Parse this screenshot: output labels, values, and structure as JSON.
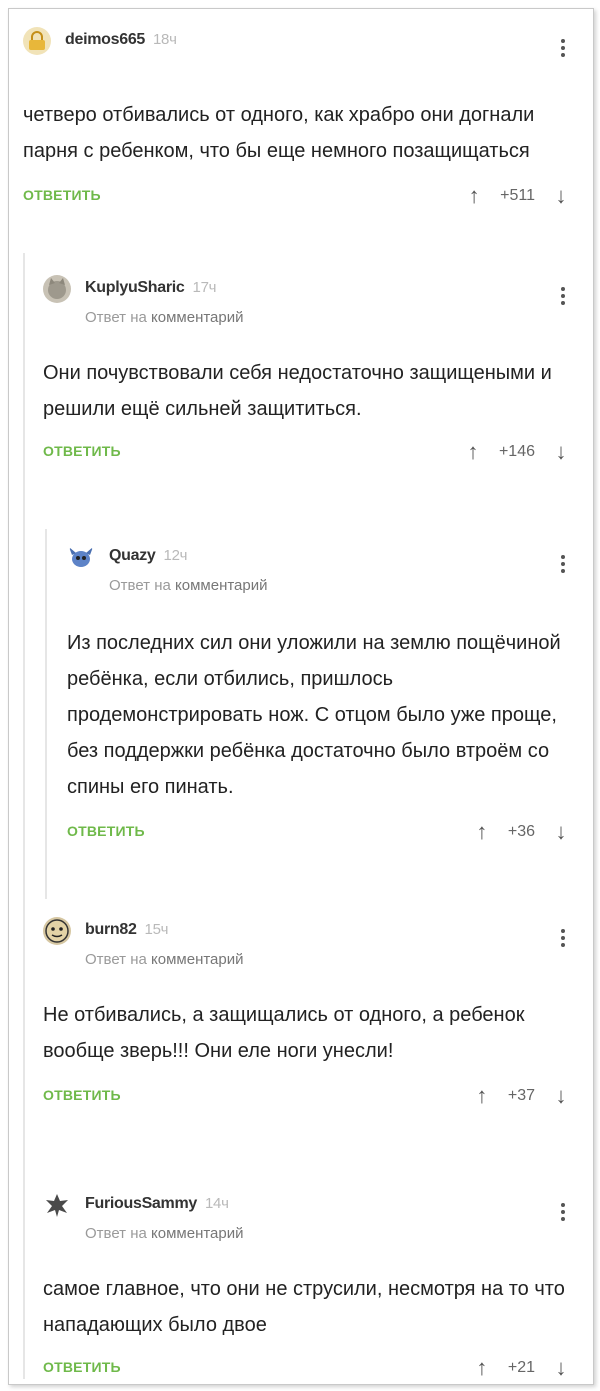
{
  "comments": [
    {
      "author": "deimos665",
      "time": "18ч",
      "reply_prefix": "",
      "reply_target": "",
      "text": "четверо отбивались от одного, как храбро они догнали парня с ребенком, что бы еще немного позащищаться",
      "answer": "ОТВЕТИТЬ",
      "score": "+511"
    },
    {
      "author": "KuplyuSharic",
      "time": "17ч",
      "reply_prefix": "Ответ на",
      "reply_target": "комментарий",
      "text": "Они почувствовали себя недостаточно защищеными и решили ещё сильней защититься.",
      "answer": "ОТВЕТИТЬ",
      "score": "+146"
    },
    {
      "author": "Quazy",
      "time": "12ч",
      "reply_prefix": "Ответ на",
      "reply_target": "комментарий",
      "text": "Из последних сил они уложили на землю пощёчиной ребёнка, если отбились, пришлось продемонстрировать нож. С отцом было уже проще, без поддержки ребёнка достаточно было втроём со спины его пинать.",
      "answer": "ОТВЕТИТЬ",
      "score": "+36"
    },
    {
      "author": "burn82",
      "time": "15ч",
      "reply_prefix": "Ответ на",
      "reply_target": "комментарий",
      "text": "Не отбивались, а защищались от одного, а ребенок вообще зверь!!! Они еле ноги унесли!",
      "answer": "ОТВЕТИТЬ",
      "score": "+37"
    },
    {
      "author": "FuriousSammy",
      "time": "14ч",
      "reply_prefix": "Ответ на",
      "reply_target": "комментарий",
      "text": "самое главное, что они не струсили, несмотря на то что нападающих было двое",
      "answer": "ОТВЕТИТЬ",
      "score": "+21"
    }
  ],
  "icons": {
    "menu": "more-vertical-icon",
    "upvote": "arrow-up-icon",
    "downvote": "arrow-down-icon"
  },
  "colors": {
    "answer": "#6fb94a",
    "text": "#222222",
    "muted": "#9a9a9a"
  }
}
